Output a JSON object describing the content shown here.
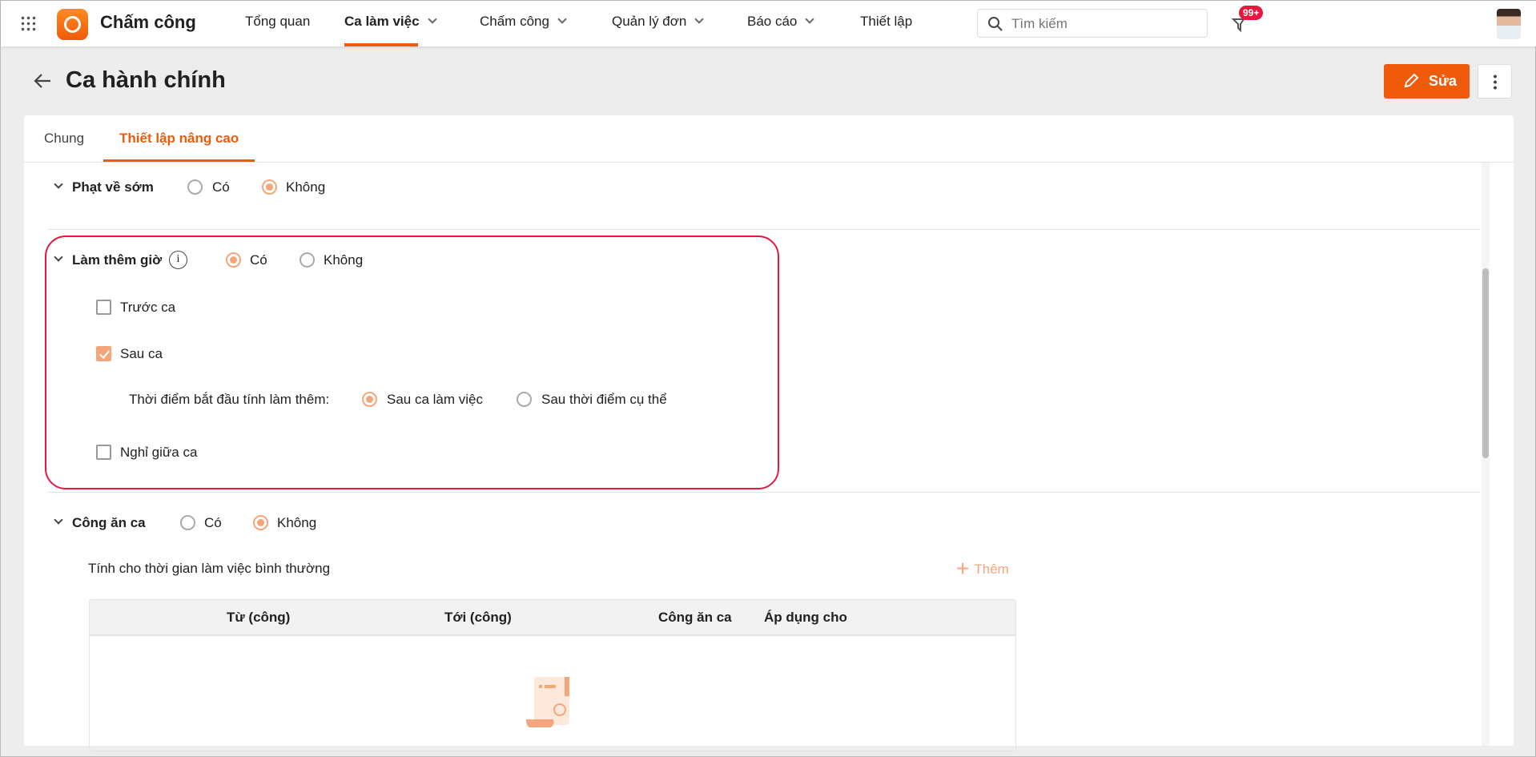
{
  "app": {
    "name": "Chấm công",
    "brand_color": "#f05a0b"
  },
  "nav": [
    {
      "label": "Tổng quan"
    },
    {
      "label": "Ca làm việc",
      "active": true
    },
    {
      "label": "Chấm công"
    },
    {
      "label": "Quản lý đơn"
    },
    {
      "label": "Báo cáo"
    },
    {
      "label": "Thiết lập"
    }
  ],
  "search": {
    "placeholder": "Tìm kiếm"
  },
  "notifications": {
    "badge": "99+"
  },
  "page": {
    "title": "Ca hành chính",
    "edit_label": "Sửa"
  },
  "tabs": [
    {
      "label": "Chung"
    },
    {
      "label": "Thiết lập nâng cao",
      "active": true
    }
  ],
  "sections": {
    "early_leave": {
      "label": "Phạt về sớm",
      "yes": "Có",
      "no": "Không",
      "selected": "no"
    },
    "overtime": {
      "label": "Làm thêm giờ",
      "yes": "Có",
      "no": "Không",
      "selected": "yes",
      "before": {
        "label": "Trước ca",
        "checked": false
      },
      "after": {
        "label": "Sau ca",
        "checked": true
      },
      "start_label": "Thời điểm bắt đầu tính làm thêm:",
      "start_opt1": "Sau ca làm việc",
      "start_opt2": "Sau thời điểm cụ thể",
      "start_selected": "opt1",
      "break": {
        "label": "Nghỉ giữa ca",
        "checked": false
      }
    },
    "meal": {
      "label": "Công ăn ca",
      "yes": "Có",
      "no": "Không",
      "selected": "no",
      "sub_label": "Tính cho thời gian làm việc bình thường",
      "add_label": "Thêm",
      "columns": [
        "Từ (công)",
        "Tới (công)",
        "Công ăn ca",
        "Áp dụng cho"
      ],
      "rows": []
    }
  },
  "colors": {
    "accent_light": "#f4a57a",
    "highlight_border": "#e8173f"
  }
}
